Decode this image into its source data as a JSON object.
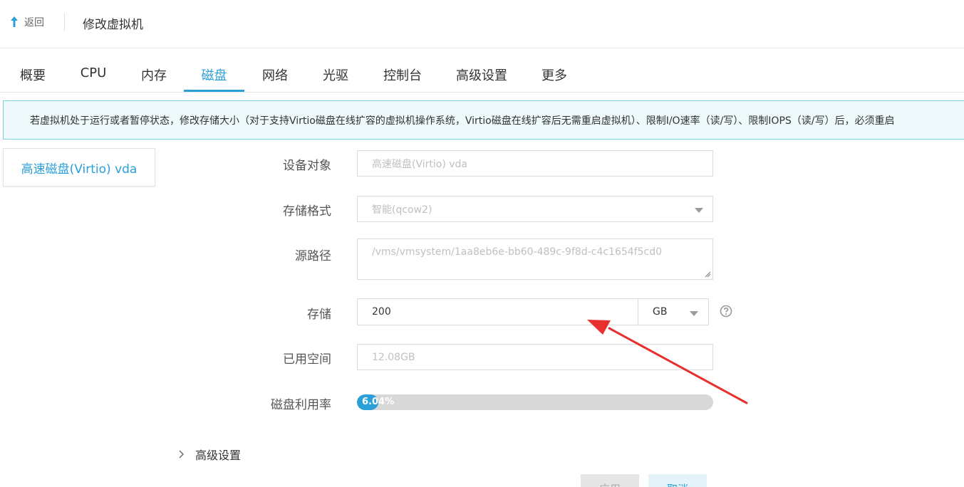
{
  "header": {
    "back_label": "返回",
    "title": "修改虚拟机"
  },
  "tabs": [
    {
      "label": "概要"
    },
    {
      "label": "CPU"
    },
    {
      "label": "内存"
    },
    {
      "label": "磁盘",
      "active": true
    },
    {
      "label": "网络"
    },
    {
      "label": "光驱"
    },
    {
      "label": "控制台"
    },
    {
      "label": "高级设置"
    },
    {
      "label": "更多"
    }
  ],
  "notice": {
    "text": "若虚拟机处于运行或者暂停状态，修改存储大小（对于支持Virtio磁盘在线扩容的虚拟机操作系统，Virtio磁盘在线扩容后无需重启虚拟机）、限制I/O速率（读/写）、限制IOPS（读/写）后，必须重启"
  },
  "disk_list": [
    {
      "label": "高速磁盘(Virtio) vda"
    }
  ],
  "form": {
    "device": {
      "label": "设备对象",
      "value": "高速磁盘(Virtio) vda"
    },
    "format": {
      "label": "存储格式",
      "value": "智能(qcow2)"
    },
    "source": {
      "label": "源路径",
      "value": "/vms/vmsystem/1aa8eb6e-bb60-489c-9f8d-c4c1654f5cd0"
    },
    "storage": {
      "label": "存储",
      "value": "200",
      "unit": "GB"
    },
    "used": {
      "label": "已用空间",
      "value": "12.08GB"
    },
    "usage": {
      "label": "磁盘利用率",
      "text": "6.04%",
      "percent": 6.04
    }
  },
  "advanced": {
    "label": "高级设置"
  },
  "buttons": {
    "apply": "应用",
    "cancel": "取消"
  },
  "colors": {
    "accent": "#2a9fd8",
    "annotation_arrow": "#e8312f"
  },
  "icons": {
    "back": "arrow-up-back-icon",
    "help": "question-circle-icon",
    "select": "caret-down-icon",
    "expand": "chevron-right-icon"
  }
}
